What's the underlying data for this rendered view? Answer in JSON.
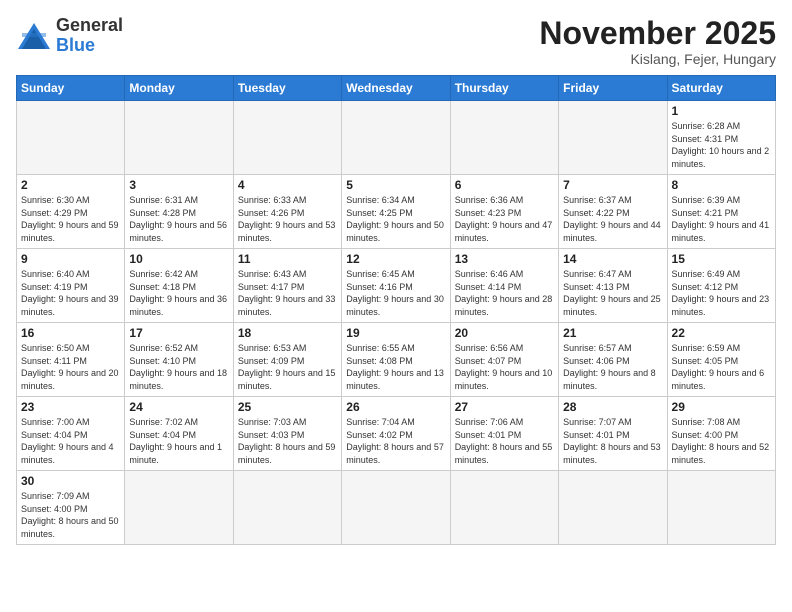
{
  "logo": {
    "text_general": "General",
    "text_blue": "Blue"
  },
  "title": "November 2025",
  "location": "Kislang, Fejer, Hungary",
  "weekdays": [
    "Sunday",
    "Monday",
    "Tuesday",
    "Wednesday",
    "Thursday",
    "Friday",
    "Saturday"
  ],
  "weeks": [
    [
      {
        "day": "",
        "info": ""
      },
      {
        "day": "",
        "info": ""
      },
      {
        "day": "",
        "info": ""
      },
      {
        "day": "",
        "info": ""
      },
      {
        "day": "",
        "info": ""
      },
      {
        "day": "",
        "info": ""
      },
      {
        "day": "1",
        "info": "Sunrise: 6:28 AM\nSunset: 4:31 PM\nDaylight: 10 hours and 2 minutes."
      }
    ],
    [
      {
        "day": "2",
        "info": "Sunrise: 6:30 AM\nSunset: 4:29 PM\nDaylight: 9 hours and 59 minutes."
      },
      {
        "day": "3",
        "info": "Sunrise: 6:31 AM\nSunset: 4:28 PM\nDaylight: 9 hours and 56 minutes."
      },
      {
        "day": "4",
        "info": "Sunrise: 6:33 AM\nSunset: 4:26 PM\nDaylight: 9 hours and 53 minutes."
      },
      {
        "day": "5",
        "info": "Sunrise: 6:34 AM\nSunset: 4:25 PM\nDaylight: 9 hours and 50 minutes."
      },
      {
        "day": "6",
        "info": "Sunrise: 6:36 AM\nSunset: 4:23 PM\nDaylight: 9 hours and 47 minutes."
      },
      {
        "day": "7",
        "info": "Sunrise: 6:37 AM\nSunset: 4:22 PM\nDaylight: 9 hours and 44 minutes."
      },
      {
        "day": "8",
        "info": "Sunrise: 6:39 AM\nSunset: 4:21 PM\nDaylight: 9 hours and 41 minutes."
      }
    ],
    [
      {
        "day": "9",
        "info": "Sunrise: 6:40 AM\nSunset: 4:19 PM\nDaylight: 9 hours and 39 minutes."
      },
      {
        "day": "10",
        "info": "Sunrise: 6:42 AM\nSunset: 4:18 PM\nDaylight: 9 hours and 36 minutes."
      },
      {
        "day": "11",
        "info": "Sunrise: 6:43 AM\nSunset: 4:17 PM\nDaylight: 9 hours and 33 minutes."
      },
      {
        "day": "12",
        "info": "Sunrise: 6:45 AM\nSunset: 4:16 PM\nDaylight: 9 hours and 30 minutes."
      },
      {
        "day": "13",
        "info": "Sunrise: 6:46 AM\nSunset: 4:14 PM\nDaylight: 9 hours and 28 minutes."
      },
      {
        "day": "14",
        "info": "Sunrise: 6:47 AM\nSunset: 4:13 PM\nDaylight: 9 hours and 25 minutes."
      },
      {
        "day": "15",
        "info": "Sunrise: 6:49 AM\nSunset: 4:12 PM\nDaylight: 9 hours and 23 minutes."
      }
    ],
    [
      {
        "day": "16",
        "info": "Sunrise: 6:50 AM\nSunset: 4:11 PM\nDaylight: 9 hours and 20 minutes."
      },
      {
        "day": "17",
        "info": "Sunrise: 6:52 AM\nSunset: 4:10 PM\nDaylight: 9 hours and 18 minutes."
      },
      {
        "day": "18",
        "info": "Sunrise: 6:53 AM\nSunset: 4:09 PM\nDaylight: 9 hours and 15 minutes."
      },
      {
        "day": "19",
        "info": "Sunrise: 6:55 AM\nSunset: 4:08 PM\nDaylight: 9 hours and 13 minutes."
      },
      {
        "day": "20",
        "info": "Sunrise: 6:56 AM\nSunset: 4:07 PM\nDaylight: 9 hours and 10 minutes."
      },
      {
        "day": "21",
        "info": "Sunrise: 6:57 AM\nSunset: 4:06 PM\nDaylight: 9 hours and 8 minutes."
      },
      {
        "day": "22",
        "info": "Sunrise: 6:59 AM\nSunset: 4:05 PM\nDaylight: 9 hours and 6 minutes."
      }
    ],
    [
      {
        "day": "23",
        "info": "Sunrise: 7:00 AM\nSunset: 4:04 PM\nDaylight: 9 hours and 4 minutes."
      },
      {
        "day": "24",
        "info": "Sunrise: 7:02 AM\nSunset: 4:04 PM\nDaylight: 9 hours and 1 minute."
      },
      {
        "day": "25",
        "info": "Sunrise: 7:03 AM\nSunset: 4:03 PM\nDaylight: 8 hours and 59 minutes."
      },
      {
        "day": "26",
        "info": "Sunrise: 7:04 AM\nSunset: 4:02 PM\nDaylight: 8 hours and 57 minutes."
      },
      {
        "day": "27",
        "info": "Sunrise: 7:06 AM\nSunset: 4:01 PM\nDaylight: 8 hours and 55 minutes."
      },
      {
        "day": "28",
        "info": "Sunrise: 7:07 AM\nSunset: 4:01 PM\nDaylight: 8 hours and 53 minutes."
      },
      {
        "day": "29",
        "info": "Sunrise: 7:08 AM\nSunset: 4:00 PM\nDaylight: 8 hours and 52 minutes."
      }
    ],
    [
      {
        "day": "30",
        "info": "Sunrise: 7:09 AM\nSunset: 4:00 PM\nDaylight: 8 hours and 50 minutes."
      },
      {
        "day": "",
        "info": ""
      },
      {
        "day": "",
        "info": ""
      },
      {
        "day": "",
        "info": ""
      },
      {
        "day": "",
        "info": ""
      },
      {
        "day": "",
        "info": ""
      },
      {
        "day": "",
        "info": ""
      }
    ]
  ]
}
